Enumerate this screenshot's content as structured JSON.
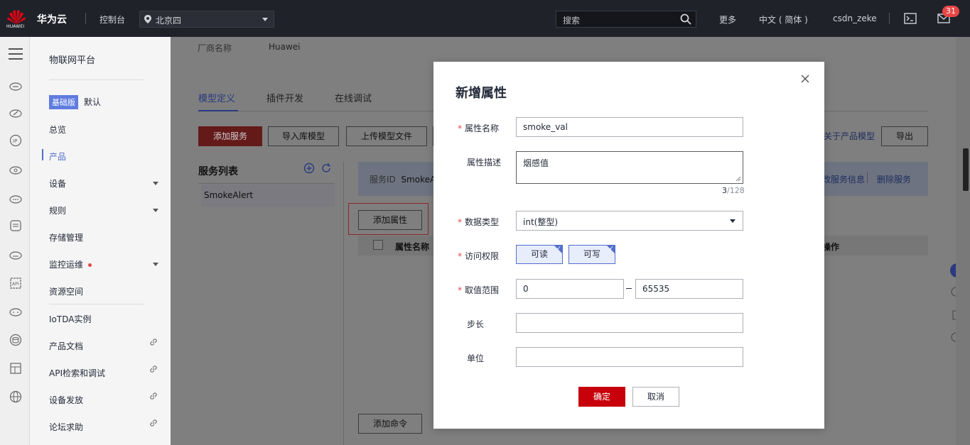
{
  "header": {
    "brand": "华为云",
    "logo_text": "HUAWEI",
    "console": "控制台",
    "region": "北京四",
    "search_placeholder": "搜索",
    "more": "更多",
    "language": "中文 ( 简体 )",
    "user": "csdn_zeke",
    "notification_count": "31"
  },
  "nav": {
    "title": "物联网平台",
    "edition_badge": "基础版",
    "edition_name": "默认",
    "items": [
      {
        "label": "总览"
      },
      {
        "label": "产品"
      },
      {
        "label": "设备"
      },
      {
        "label": "规则"
      },
      {
        "label": "存储管理"
      },
      {
        "label": "监控运维"
      },
      {
        "label": "资源空间"
      },
      {
        "label": "IoTDA实例"
      },
      {
        "label": "产品文档"
      },
      {
        "label": "API检索和调试"
      },
      {
        "label": "设备发放"
      },
      {
        "label": "论坛求助"
      }
    ]
  },
  "product": {
    "vendor_label": "厂商名称",
    "vendor_value": "Huawei"
  },
  "tabs": [
    "模型定义",
    "插件开发",
    "在线调试"
  ],
  "toolbar": {
    "add_service": "添加服务",
    "import_model": "导入库模型",
    "upload_model": "上传模型文件",
    "about_model": "关于产品模型",
    "export": "导出"
  },
  "services": {
    "title": "服务列表",
    "items": [
      "SmokeAlert"
    ],
    "info_label": "服务ID",
    "info_value": "SmokeA",
    "edit_link": "改服务信息",
    "delete_link": "删除服务",
    "add_property": "添加属性",
    "add_command": "添加命令",
    "col_name": "属性名称",
    "col_ops": "操作"
  },
  "modal": {
    "title": "新增属性",
    "fields": {
      "name_label": "属性名称",
      "name_value": "smoke_val",
      "desc_label": "属性描述",
      "desc_value": "烟感值",
      "desc_count_current": "3",
      "desc_count_max": "/128",
      "type_label": "数据类型",
      "type_value": "int(整型)",
      "access_label": "访问权限",
      "access_read": "可读",
      "access_write": "可写",
      "range_label": "取值范围",
      "range_min": "0",
      "range_max": "65535",
      "step_label": "步长",
      "step_value": "",
      "unit_label": "单位",
      "unit_value": ""
    },
    "confirm": "确定",
    "cancel": "取消"
  },
  "colors": {
    "topbar": "#20222a",
    "accent": "#526ecc",
    "primary_red": "#c7000b",
    "required_star": "#e84545"
  }
}
